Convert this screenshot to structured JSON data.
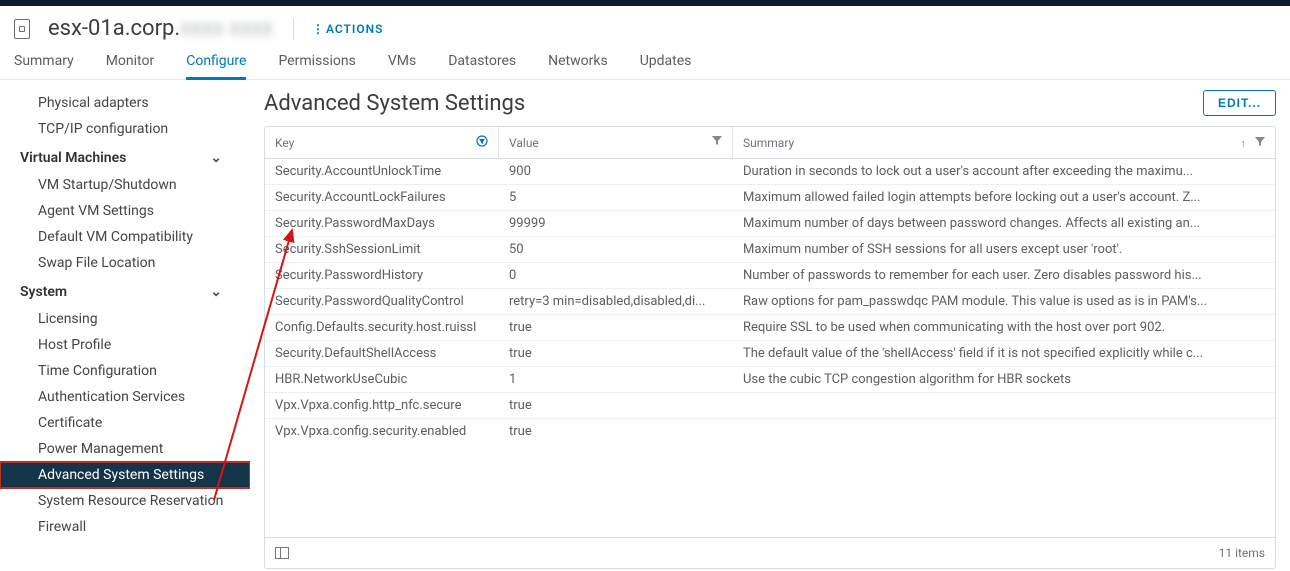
{
  "header": {
    "host_name_visible": "esx-01a.corp.",
    "host_name_blurred": "xxxx xxxx",
    "actions_label": "ACTIONS"
  },
  "tabs": [
    {
      "label": "Summary",
      "active": false
    },
    {
      "label": "Monitor",
      "active": false
    },
    {
      "label": "Configure",
      "active": true
    },
    {
      "label": "Permissions",
      "active": false
    },
    {
      "label": "VMs",
      "active": false
    },
    {
      "label": "Datastores",
      "active": false
    },
    {
      "label": "Networks",
      "active": false
    },
    {
      "label": "Updates",
      "active": false
    }
  ],
  "sidebar": [
    {
      "type": "item",
      "label": "Physical adapters"
    },
    {
      "type": "item",
      "label": "TCP/IP configuration"
    },
    {
      "type": "group",
      "label": "Virtual Machines"
    },
    {
      "type": "item",
      "label": "VM Startup/Shutdown"
    },
    {
      "type": "item",
      "label": "Agent VM Settings"
    },
    {
      "type": "item",
      "label": "Default VM Compatibility"
    },
    {
      "type": "item",
      "label": "Swap File Location"
    },
    {
      "type": "group",
      "label": "System"
    },
    {
      "type": "item",
      "label": "Licensing"
    },
    {
      "type": "item",
      "label": "Host Profile"
    },
    {
      "type": "item",
      "label": "Time Configuration"
    },
    {
      "type": "item",
      "label": "Authentication Services"
    },
    {
      "type": "item",
      "label": "Certificate"
    },
    {
      "type": "item",
      "label": "Power Management"
    },
    {
      "type": "item",
      "label": "Advanced System Settings",
      "active": true
    },
    {
      "type": "item",
      "label": "System Resource Reservation"
    },
    {
      "type": "item",
      "label": "Firewall"
    }
  ],
  "content": {
    "title": "Advanced System Settings",
    "edit_label": "EDIT..."
  },
  "table": {
    "columns": {
      "key": "Key",
      "value": "Value",
      "summary": "Summary"
    },
    "rows": [
      {
        "key": "Security.AccountUnlockTime",
        "value": "900",
        "summary": "Duration in seconds to lock out a user's account after exceeding the maximu..."
      },
      {
        "key": "Security.AccountLockFailures",
        "value": "5",
        "summary": "Maximum allowed failed login attempts before locking out a user's account. Z..."
      },
      {
        "key": "Security.PasswordMaxDays",
        "value": "99999",
        "summary": "Maximum number of days between password changes. Affects all existing an..."
      },
      {
        "key": "Security.SshSessionLimit",
        "value": "50",
        "summary": "Maximum number of SSH sessions for all users except user 'root'."
      },
      {
        "key": "Security.PasswordHistory",
        "value": "0",
        "summary": "Number of passwords to remember for each user. Zero disables password his..."
      },
      {
        "key": "Security.PasswordQualityControl",
        "value": "retry=3 min=disabled,disabled,di...",
        "summary": "Raw options for pam_passwdqc PAM module. This value is used as is in PAM's..."
      },
      {
        "key": "Config.Defaults.security.host.ruissl",
        "value": "true",
        "summary": "Require SSL to be used when communicating with the host over port 902."
      },
      {
        "key": "Security.DefaultShellAccess",
        "value": "true",
        "summary": "The default value of the 'shellAccess' field if it is not specified explicitly while c..."
      },
      {
        "key": "HBR.NetworkUseCubic",
        "value": "1",
        "summary": "Use the cubic TCP congestion algorithm for HBR sockets"
      },
      {
        "key": "Vpx.Vpxa.config.http_nfc.secure",
        "value": "true",
        "summary": ""
      },
      {
        "key": "Vpx.Vpxa.config.security.enabled",
        "value": "true",
        "summary": ""
      }
    ],
    "footer_count": "11 items"
  }
}
